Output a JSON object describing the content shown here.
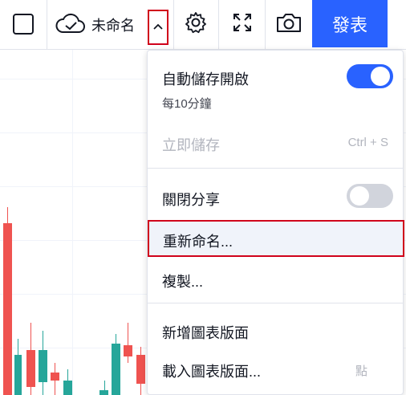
{
  "toolbar": {
    "layout_name": "未命名",
    "publish_label": "發表",
    "icons": [
      "square-icon",
      "cloud-check-icon",
      "chevron-up-icon",
      "gear-icon",
      "fullscreen-icon",
      "camera-icon"
    ]
  },
  "menu": {
    "autosave": {
      "label": "自動儲存開啟",
      "sub": "每10分鐘",
      "toggle_on": true
    },
    "save_now": {
      "label": "立即儲存",
      "shortcut": "Ctrl + S"
    },
    "share": {
      "label": "關閉分享",
      "toggle_on": false
    },
    "rename": {
      "label": "重新命名..."
    },
    "copy": {
      "label": "複製..."
    },
    "new_layout": {
      "label": "新增圖表版面"
    },
    "load_layout": {
      "label": "載入圖表版面...",
      "shortcut": "點"
    }
  },
  "colors": {
    "accent": "#2962ff",
    "highlight_border": "#d0021b",
    "candle_up": "#26a69a",
    "candle_down": "#ef5350"
  }
}
